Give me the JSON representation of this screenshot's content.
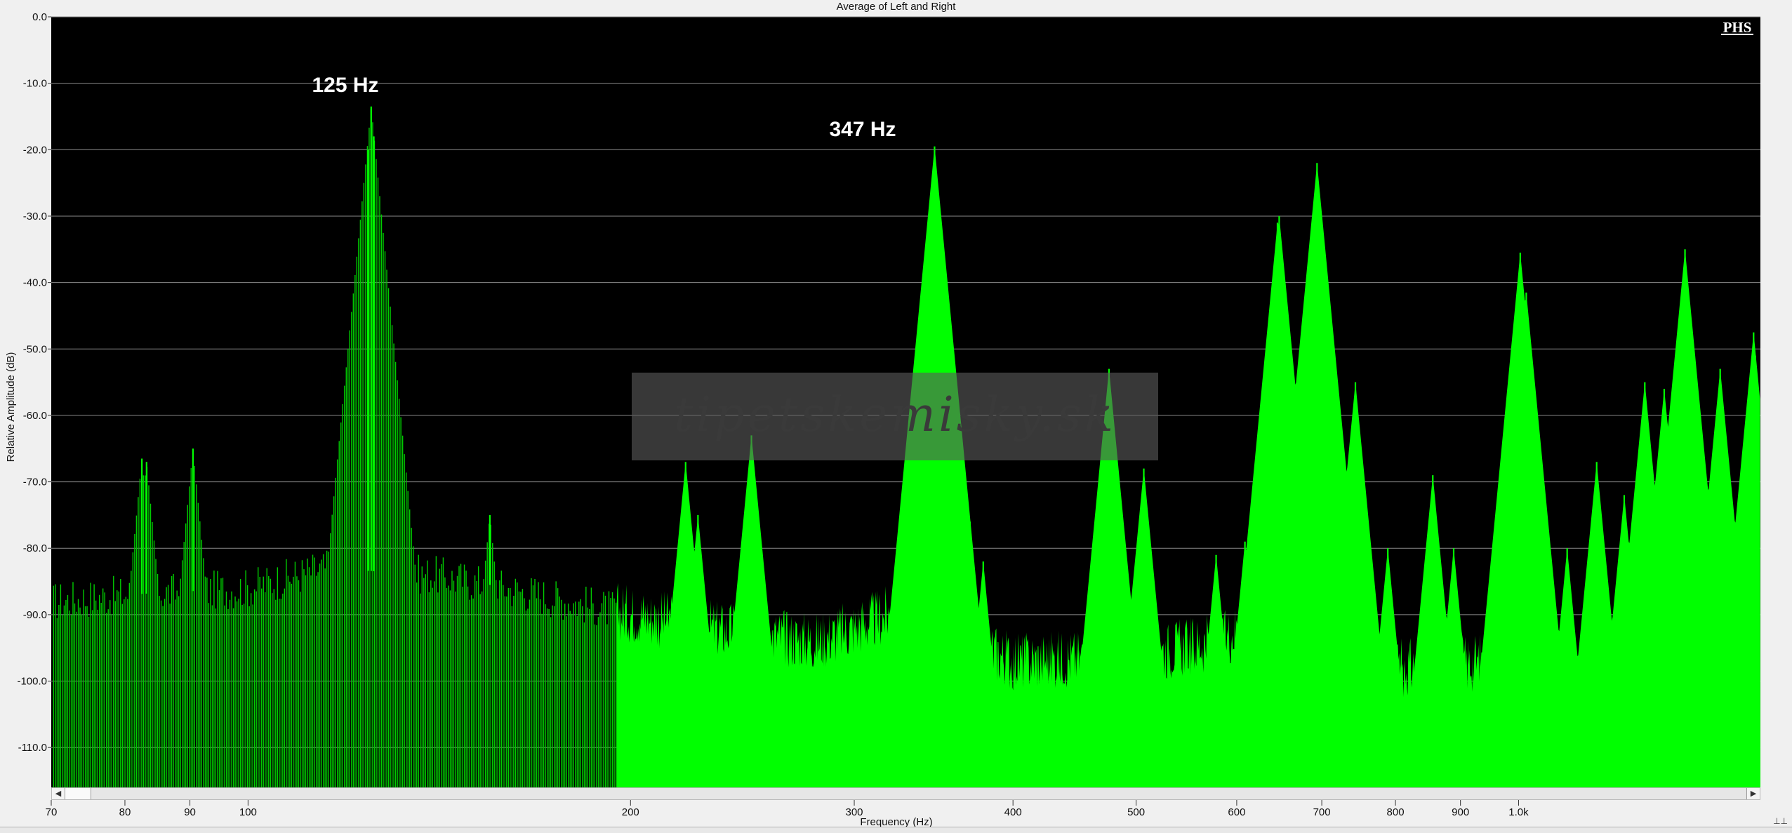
{
  "window": {
    "title": "Average of Left and Right"
  },
  "colors": {
    "plot_background": "#000000",
    "spectrum_fill": "#00ff00",
    "spectrum_edge": "#00cc00",
    "grid": "#8a8a8a",
    "chrome": "#f0f0f0",
    "annotation_text": "#ffffff"
  },
  "icons": {
    "scroll_left": "◀",
    "scroll_right": "▶",
    "corner": "⊥⊥"
  },
  "watermark": {
    "text": "tipetskemisky.sk",
    "badge": "PHS"
  },
  "chart_data": {
    "type": "area",
    "title": "Average of Left and Right",
    "xlabel": "Frequency (Hz)",
    "ylabel": "Relative Amplitude (dB)",
    "x_scale": "log",
    "xlim": [
      70,
      1550
    ],
    "ylim": [
      -116,
      0
    ],
    "grid": true,
    "legend": "none",
    "x_ticks": [
      {
        "value": 70,
        "label": "70"
      },
      {
        "value": 80,
        "label": "80"
      },
      {
        "value": 90,
        "label": "90"
      },
      {
        "value": 100,
        "label": "100"
      },
      {
        "value": 200,
        "label": "200"
      },
      {
        "value": 300,
        "label": "300"
      },
      {
        "value": 400,
        "label": "400"
      },
      {
        "value": 500,
        "label": "500"
      },
      {
        "value": 600,
        "label": "600"
      },
      {
        "value": 700,
        "label": "700"
      },
      {
        "value": 800,
        "label": "800"
      },
      {
        "value": 900,
        "label": "900"
      },
      {
        "value": 1000,
        "label": "1.0k"
      }
    ],
    "y_ticks": [
      {
        "value": 0,
        "label": "0.0"
      },
      {
        "value": -10,
        "label": "-10.0"
      },
      {
        "value": -20,
        "label": "-20.0"
      },
      {
        "value": -30,
        "label": "-30.0"
      },
      {
        "value": -40,
        "label": "-40.0"
      },
      {
        "value": -50,
        "label": "-50.0"
      },
      {
        "value": -60,
        "label": "-60.0"
      },
      {
        "value": -70,
        "label": "-70.0"
      },
      {
        "value": -80,
        "label": "-80.0"
      },
      {
        "value": -90,
        "label": "-90.0"
      },
      {
        "value": -100,
        "label": "-100.0"
      },
      {
        "value": -110,
        "label": "-110.0"
      }
    ],
    "annotations": [
      {
        "text": "125 Hz",
        "x": 125,
        "y": -13.5
      },
      {
        "text": "347 Hz",
        "x": 347,
        "y": -19.5
      }
    ],
    "noise_floor": [
      {
        "x": 70,
        "y": -88
      },
      {
        "x": 80,
        "y": -87
      },
      {
        "x": 100,
        "y": -86
      },
      {
        "x": 115,
        "y": -83
      },
      {
        "x": 140,
        "y": -84
      },
      {
        "x": 160,
        "y": -86
      },
      {
        "x": 190,
        "y": -89
      },
      {
        "x": 230,
        "y": -92
      },
      {
        "x": 280,
        "y": -94
      },
      {
        "x": 330,
        "y": -89
      },
      {
        "x": 400,
        "y": -97
      },
      {
        "x": 500,
        "y": -96
      },
      {
        "x": 580,
        "y": -94
      },
      {
        "x": 630,
        "y": -90
      },
      {
        "x": 700,
        "y": -92
      },
      {
        "x": 800,
        "y": -98
      },
      {
        "x": 950,
        "y": -97
      },
      {
        "x": 1150,
        "y": -99
      },
      {
        "x": 1300,
        "y": -99
      },
      {
        "x": 1400,
        "y": -102
      },
      {
        "x": 1550,
        "y": -99
      }
    ],
    "peaks": [
      {
        "x": 82.5,
        "y": -66.5
      },
      {
        "x": 83.2,
        "y": -67
      },
      {
        "x": 90.5,
        "y": -65
      },
      {
        "x": 125,
        "y": -13.5
      },
      {
        "x": 125.6,
        "y": -18
      },
      {
        "x": 124.3,
        "y": -20
      },
      {
        "x": 155,
        "y": -75
      },
      {
        "x": 221,
        "y": -67
      },
      {
        "x": 226,
        "y": -75
      },
      {
        "x": 249,
        "y": -63
      },
      {
        "x": 347,
        "y": -19.5
      },
      {
        "x": 350,
        "y": -45
      },
      {
        "x": 370,
        "y": -76
      },
      {
        "x": 379,
        "y": -82
      },
      {
        "x": 476,
        "y": -53
      },
      {
        "x": 507,
        "y": -68
      },
      {
        "x": 578,
        "y": -81
      },
      {
        "x": 609,
        "y": -79
      },
      {
        "x": 648,
        "y": -30
      },
      {
        "x": 646,
        "y": -31
      },
      {
        "x": 694,
        "y": -22
      },
      {
        "x": 744,
        "y": -55
      },
      {
        "x": 789,
        "y": -80
      },
      {
        "x": 856,
        "y": -69
      },
      {
        "x": 889,
        "y": -80
      },
      {
        "x": 990,
        "y": -50
      },
      {
        "x": 1003,
        "y": -35.5
      },
      {
        "x": 1014,
        "y": -41.5
      },
      {
        "x": 1092,
        "y": -80
      },
      {
        "x": 1152,
        "y": -67
      },
      {
        "x": 1211,
        "y": -72
      },
      {
        "x": 1257,
        "y": -55
      },
      {
        "x": 1302,
        "y": -56
      },
      {
        "x": 1352,
        "y": -35
      },
      {
        "x": 1360,
        "y": -41.5
      },
      {
        "x": 1395,
        "y": -76
      },
      {
        "x": 1441,
        "y": -53
      },
      {
        "x": 1462,
        "y": -67
      },
      {
        "x": 1531,
        "y": -47.5
      },
      {
        "x": 1536,
        "y": -51
      }
    ]
  }
}
